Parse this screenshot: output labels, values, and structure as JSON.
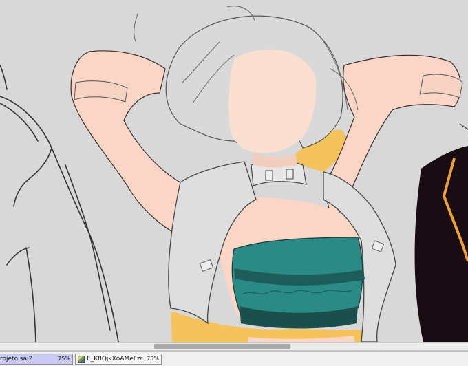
{
  "window": {
    "tabs": [
      {
        "name": "rojeto.sai2",
        "zoom": "75%",
        "active": true
      },
      {
        "name": "E_K8QjkXoAMeFzr....",
        "zoom": "75%",
        "active": false
      }
    ]
  },
  "canvas": {
    "background_color": "#d8d8d8",
    "skin_color": "#fbd6c6",
    "top_color": "#2a8a85",
    "accent_color": "#f5c35c",
    "dark_figure_color": "#170d12"
  },
  "scrollbar": {
    "position_fraction": 0.33,
    "visible_fraction": 0.29
  }
}
